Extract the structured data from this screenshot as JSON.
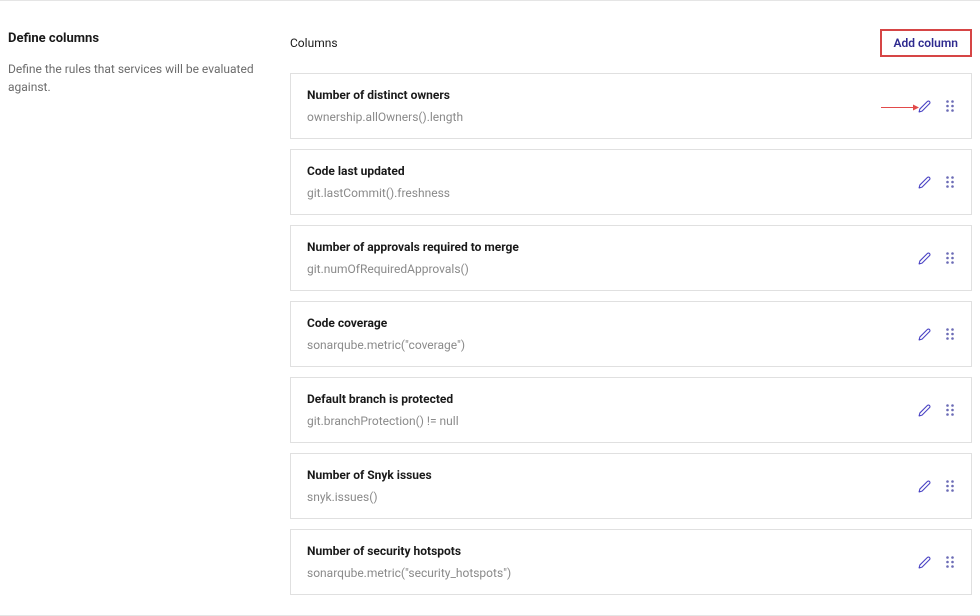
{
  "sidebar": {
    "title": "Define columns",
    "description": "Define the rules that services will be evaluated against."
  },
  "header": {
    "columns_label": "Columns",
    "add_column_label": "Add column"
  },
  "columns": [
    {
      "title": "Number of distinct owners",
      "expression": "ownership.allOwners().length"
    },
    {
      "title": "Code last updated",
      "expression": "git.lastCommit().freshness"
    },
    {
      "title": "Number of approvals required to merge",
      "expression": "git.numOfRequiredApprovals()"
    },
    {
      "title": "Code coverage",
      "expression": "sonarqube.metric(\"coverage\")"
    },
    {
      "title": "Default branch is protected",
      "expression": "git.branchProtection() != null"
    },
    {
      "title": "Number of Snyk issues",
      "expression": "snyk.issues()"
    },
    {
      "title": "Number of security hotspots",
      "expression": "sonarqube.metric(\"security_hotspots\")"
    }
  ]
}
